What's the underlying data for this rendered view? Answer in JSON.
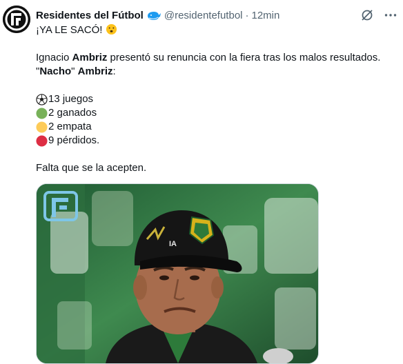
{
  "tweet": {
    "author_name": "Residentes del Fútbol",
    "handle": "@residentefutbol",
    "separator": "·",
    "time": "12min",
    "line1": "¡YA LE SACÓ! ",
    "line2_pre": "Ignacio ",
    "line2_bold": "Ambriz",
    "line2_post": " presentó su renuncia con la fiera tras los malos resultados.",
    "line3_q1": "\"",
    "line3_bold1": "Nacho",
    "line3_q2": "\" ",
    "line3_bold2": "Ambriz",
    "line3_post": ":",
    "stats": {
      "games": "13 juegos",
      "won": "2 ganados",
      "draw": "2 empata",
      "lost": "9 pérdidos."
    },
    "closing": "Falta que se la acepten."
  },
  "icons": {
    "verified": "whale-badge-icon",
    "grok": "grok-icon",
    "more": "more-icon",
    "soccer": "soccer-ball-icon"
  },
  "colors": {
    "text": "#0f1419",
    "secondary": "#536471",
    "green_circle": "#78b159",
    "yellow_circle": "#fdcb58",
    "red_circle": "#dd2e44"
  }
}
